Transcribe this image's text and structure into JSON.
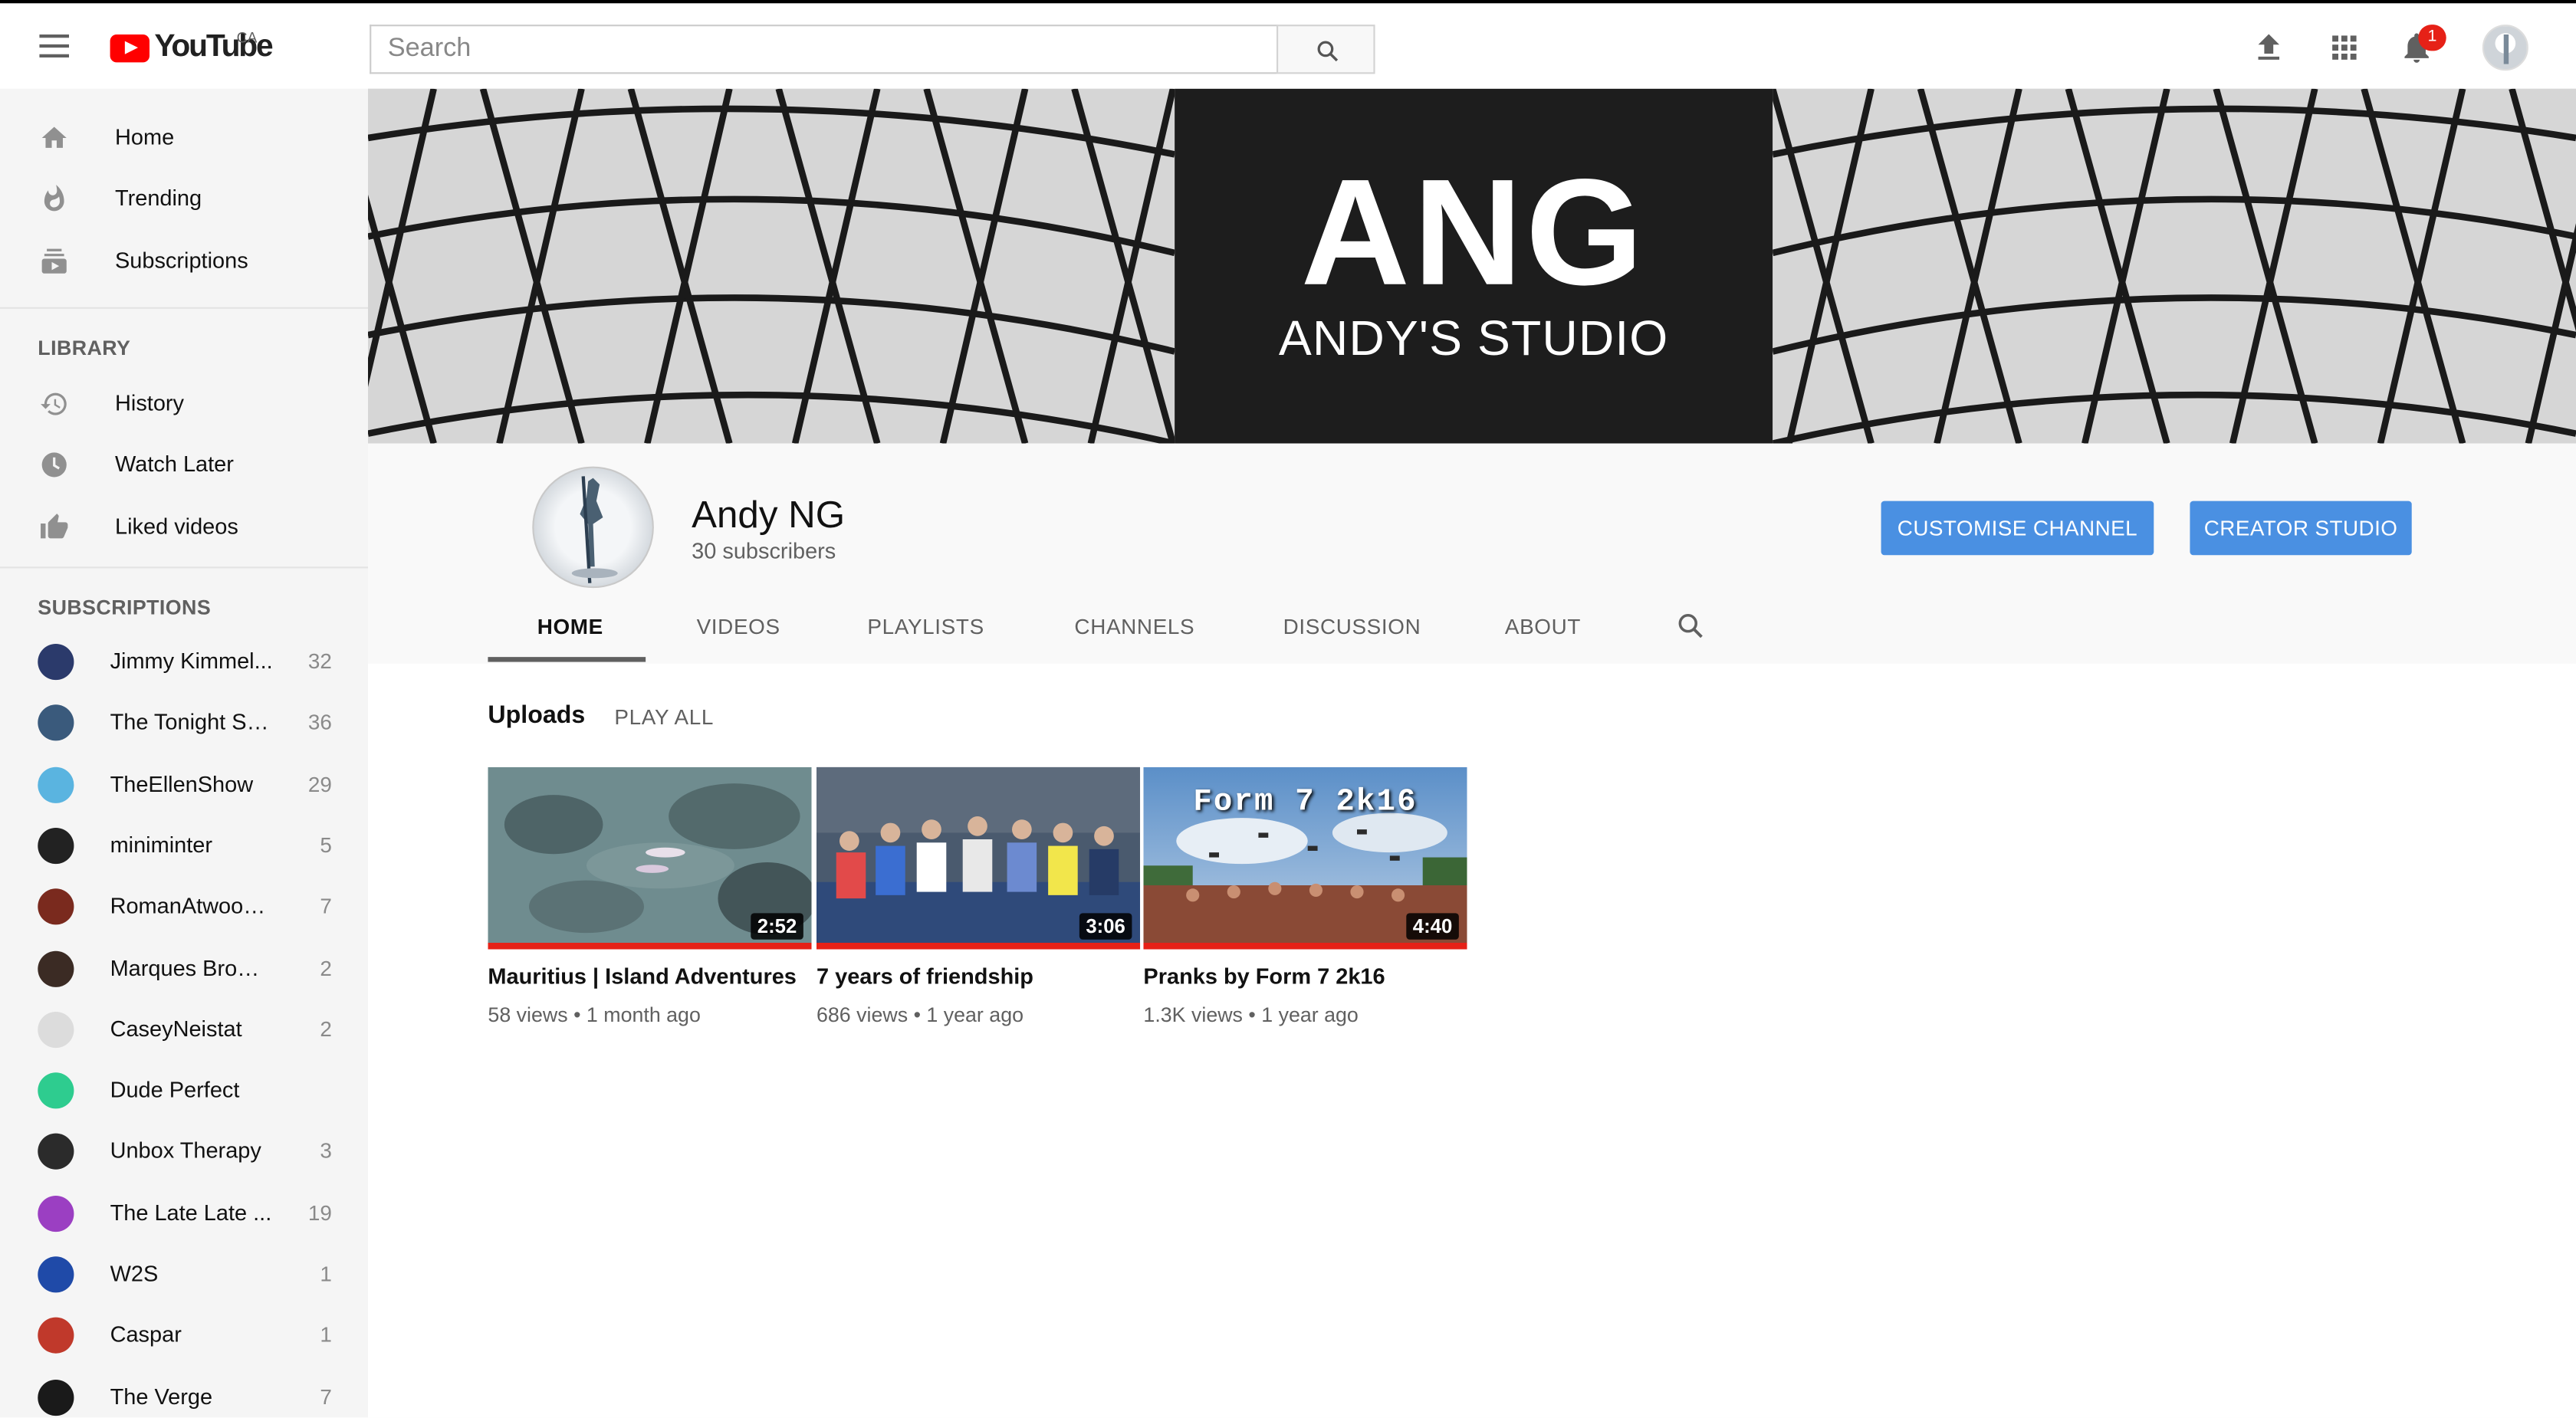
{
  "header": {
    "logo_text": "YouTube",
    "country_code": "CA",
    "search_placeholder": "Search",
    "notification_count": "1"
  },
  "sidebar": {
    "main": [
      {
        "label": "Home",
        "icon": "home-icon"
      },
      {
        "label": "Trending",
        "icon": "trending-icon"
      },
      {
        "label": "Subscriptions",
        "icon": "subscriptions-icon"
      }
    ],
    "library_title": "LIBRARY",
    "library": [
      {
        "label": "History",
        "icon": "history-icon"
      },
      {
        "label": "Watch Later",
        "icon": "watch-later-icon"
      },
      {
        "label": "Liked videos",
        "icon": "liked-videos-icon"
      }
    ],
    "subscriptions_title": "SUBSCRIPTIONS",
    "subscriptions": [
      {
        "name": "Jimmy Kimmel...",
        "count": "32",
        "color": "#2b3a6b"
      },
      {
        "name": "The Tonight Sh...",
        "count": "36",
        "color": "#3a5a7c"
      },
      {
        "name": "TheEllenShow",
        "count": "29",
        "color": "#5ab4e0"
      },
      {
        "name": "miniminter",
        "count": "5",
        "color": "#222222"
      },
      {
        "name": "RomanAtwoodV...",
        "count": "7",
        "color": "#7a2a1e"
      },
      {
        "name": "Marques Brownl...",
        "count": "2",
        "color": "#3b2b24"
      },
      {
        "name": "CaseyNeistat",
        "count": "2",
        "color": "#dcdcdc"
      },
      {
        "name": "Dude Perfect",
        "count": "",
        "color": "#2ecc8f"
      },
      {
        "name": "Unbox Therapy",
        "count": "3",
        "color": "#2b2b2b"
      },
      {
        "name": "The Late Late ...",
        "count": "19",
        "color": "#9b3fc2"
      },
      {
        "name": "W2S",
        "count": "1",
        "color": "#1f4aa8"
      },
      {
        "name": "Caspar",
        "count": "1",
        "color": "#c0392b"
      },
      {
        "name": "The Verge",
        "count": "7",
        "color": "#1a1a1a"
      }
    ]
  },
  "banner": {
    "big_text": "ANG",
    "sub_text": "ANDY'S STUDIO"
  },
  "channel": {
    "name": "Andy NG",
    "subscribers": "30 subscribers",
    "customise_label": "CUSTOMISE CHANNEL",
    "studio_label": "CREATOR STUDIO",
    "tabs": [
      "HOME",
      "VIDEOS",
      "PLAYLISTS",
      "CHANNELS",
      "DISCUSSION",
      "ABOUT"
    ],
    "active_tab": "HOME",
    "accent_color": "#4a90e2"
  },
  "uploads": {
    "title": "Uploads",
    "play_all": "PLAY ALL",
    "videos": [
      {
        "title": "Mauritius | Island Adventures",
        "duration": "2:52",
        "views": "58 views",
        "age": "1 month ago"
      },
      {
        "title": "7 years of friendship",
        "duration": "3:06",
        "views": "686 views",
        "age": "1 year ago"
      },
      {
        "title": "Pranks by Form 7 2k16",
        "duration": "4:40",
        "views": "1.3K views",
        "age": "1 year ago",
        "overlay_text": "Form 7 2k16"
      }
    ]
  }
}
